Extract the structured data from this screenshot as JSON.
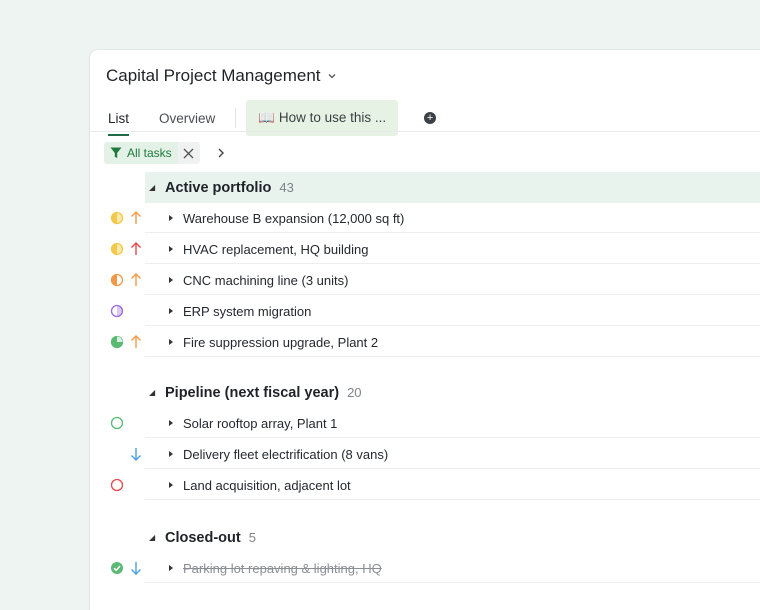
{
  "header": {
    "title": "Capital Project Management"
  },
  "tabs": [
    {
      "label": "List"
    },
    {
      "label": "Overview"
    },
    {
      "label": "📖 How to use this ..."
    }
  ],
  "filter": {
    "label": "All tasks"
  },
  "groups": [
    {
      "name": "Active portfolio",
      "count": "43",
      "tasks": [
        {
          "label": "Warehouse B expansion (12,000 sq ft)",
          "status": "half-yellow",
          "priority": "up-orange"
        },
        {
          "label": "HVAC replacement, HQ building",
          "status": "half-yellow",
          "priority": "up-red"
        },
        {
          "label": "CNC machining line (3 units)",
          "status": "half-orange",
          "priority": "up-orange"
        },
        {
          "label": "ERP system migration",
          "status": "half-purple",
          "priority": "none"
        },
        {
          "label": "Fire suppression upgrade, Plant 2",
          "status": "mostly-green",
          "priority": "up-orange"
        }
      ]
    },
    {
      "name": "Pipeline (next fiscal year)",
      "count": "20",
      "tasks": [
        {
          "label": "Solar rooftop array, Plant 1",
          "status": "empty-green",
          "priority": "none"
        },
        {
          "label": "Delivery fleet electrification (8 vans)",
          "status": "none",
          "priority": "down-blue"
        },
        {
          "label": "Land acquisition, adjacent lot",
          "status": "empty-red",
          "priority": "none"
        }
      ]
    },
    {
      "name": "Closed-out",
      "count": "5",
      "tasks": [
        {
          "label": "Parking lot repaving & lighting, HQ",
          "status": "done-green",
          "priority": "down-blue",
          "done": true
        }
      ]
    }
  ],
  "colors": {
    "accent": "#1f6b45",
    "yellow": "#f2c94c",
    "orange": "#f2994a",
    "purple": "#9b6bd6",
    "green": "#5bb974",
    "red": "#e5484d",
    "blue": "#4a9fe0"
  }
}
